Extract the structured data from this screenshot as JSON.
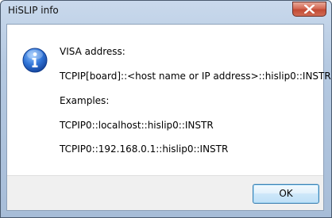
{
  "window": {
    "title": "HiSLIP info"
  },
  "dialog": {
    "icon": "info-icon",
    "lines": [
      "VISA address:",
      "TCPIP[board]::<host name or IP address>::hislip0::INSTR",
      "Examples:",
      "TCPIP0::localhost::hislip0::INSTR",
      "TCPIP0::192.168.0.1::hislip0::INSTR"
    ]
  },
  "buttons": {
    "ok_label": "OK",
    "close_icon": "close-icon"
  },
  "colors": {
    "titlebar": "#b5c9e1",
    "close_button": "#c24a34",
    "info_icon": "#1e62c8",
    "ok_border": "#3c7fb1"
  }
}
